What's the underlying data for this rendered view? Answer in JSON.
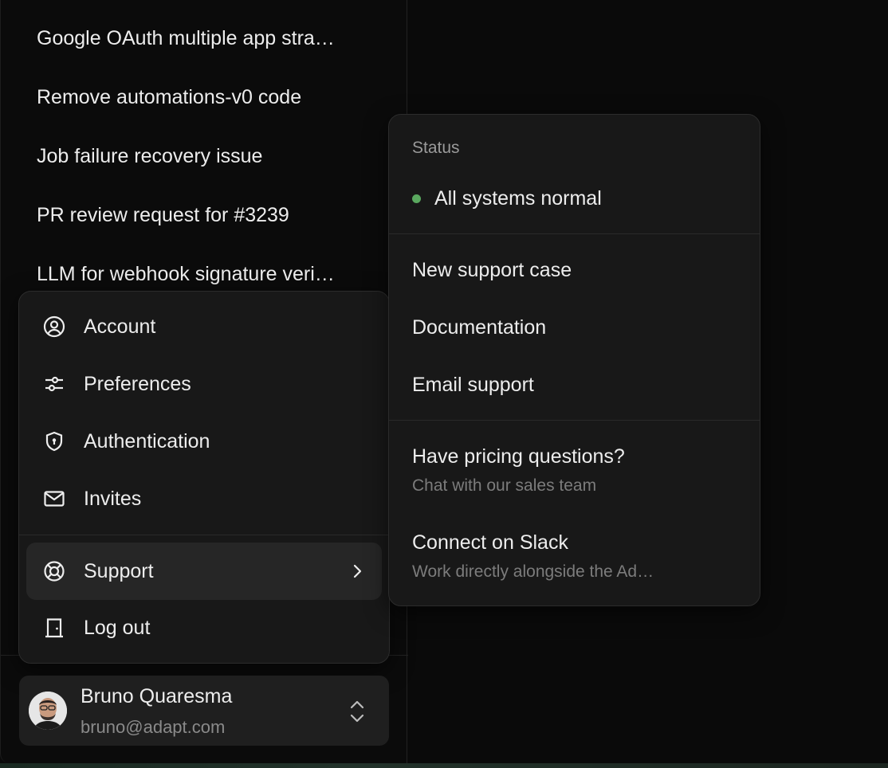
{
  "recent_chats": [
    "Google OAuth multiple app stra…",
    "Remove automations-v0 code",
    "Job failure recovery issue",
    "PR review request for #3239",
    "LLM for webhook signature veri…"
  ],
  "account_menu": {
    "items": [
      {
        "label": "Account",
        "icon": "user-circle-icon"
      },
      {
        "label": "Preferences",
        "icon": "sliders-icon"
      },
      {
        "label": "Authentication",
        "icon": "shield-lock-icon"
      },
      {
        "label": "Invites",
        "icon": "mail-icon"
      }
    ],
    "support": {
      "label": "Support",
      "icon": "lifebuoy-icon"
    },
    "logout": {
      "label": "Log out",
      "icon": "door-icon"
    }
  },
  "support_menu": {
    "status_heading": "Status",
    "status_text": "All systems normal",
    "status_color": "#5aa85f",
    "links": [
      "New support case",
      "Documentation",
      "Email support"
    ],
    "pricing": {
      "title": "Have pricing questions?",
      "subtitle": "Chat with our sales team"
    },
    "slack": {
      "title": "Connect on Slack",
      "subtitle": "Work directly alongside the Ad…"
    }
  },
  "user": {
    "name": "Bruno Quaresma",
    "email": "bruno@adapt.com"
  }
}
